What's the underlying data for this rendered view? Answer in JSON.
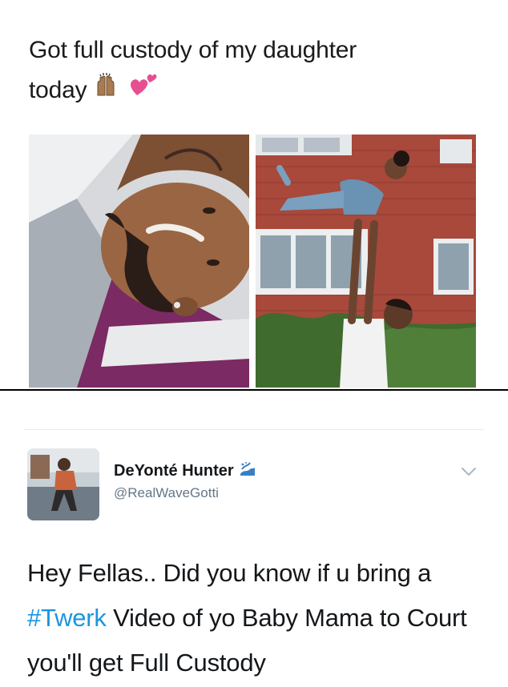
{
  "post": {
    "caption_line1": "Got full custody of my daughter",
    "caption_line2": "today",
    "emojis": [
      "raising-hands-icon",
      "two-hearts-icon"
    ],
    "photos": [
      {
        "name": "photo-man-smiling"
      },
      {
        "name": "photo-father-lifting-daughter"
      }
    ]
  },
  "tweet": {
    "display_name": "DeYonté Hunter",
    "name_emoji": "wave-icon",
    "handle": "@RealWaveGotti",
    "text_before": "Hey Fellas.. Did you know if u bring a ",
    "hashtag": "#Twerk",
    "text_after": " Video of yo Baby Mama to Court you'll get Full Custody",
    "menu_icon": "chevron-down-icon"
  },
  "colors": {
    "hashtag": "#1b95e0",
    "handle": "#657786",
    "text": "#14171a"
  }
}
